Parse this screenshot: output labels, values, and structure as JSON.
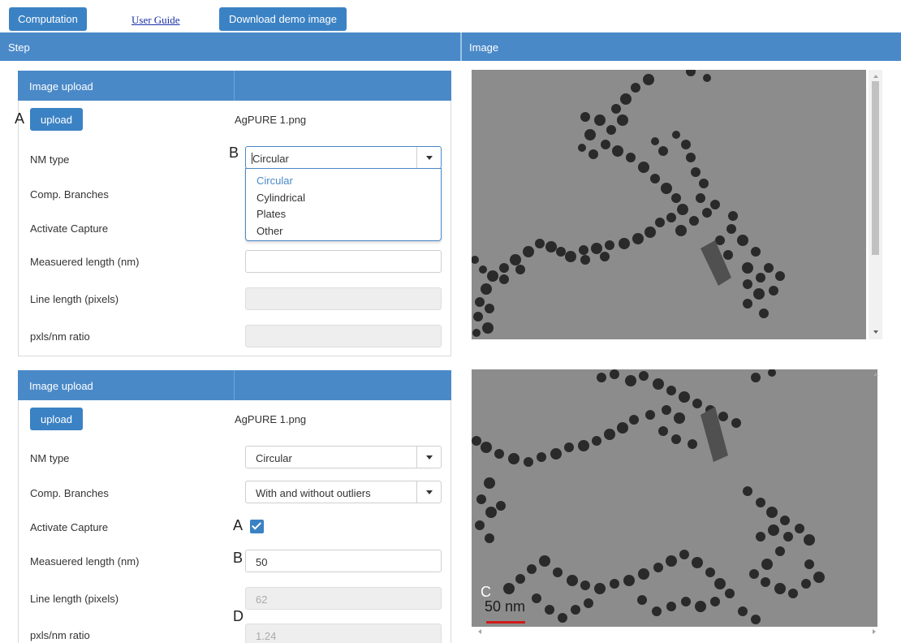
{
  "nav": {
    "computation": "Computation",
    "user_guide": "User Guide",
    "download_demo": "Download demo image"
  },
  "header": {
    "step": "Step",
    "image": "Image"
  },
  "panel1": {
    "title": "Image upload",
    "upload_label": "upload",
    "filename": "AgPURE 1.png",
    "nm_type_label": "NM type",
    "nm_type_value": "Circular",
    "nm_type_options": [
      "Circular",
      "Cylindrical",
      "Plates",
      "Other"
    ],
    "comp_branches_label": "Comp. Branches",
    "activate_capture_label": "Activate Capture",
    "measured_length_label": "Measuered length (nm)",
    "measured_length_value": "",
    "line_length_label": "Line length (pixels)",
    "line_length_value": "",
    "ratio_label": "pxls/nm ratio",
    "ratio_value": ""
  },
  "panel2": {
    "title": "Image upload",
    "upload_label": "upload",
    "filename": "AgPURE 1.png",
    "nm_type_label": "NM type",
    "nm_type_value": "Circular",
    "comp_branches_label": "Comp. Branches",
    "comp_branches_value": "With and without outliers",
    "activate_capture_label": "Activate Capture",
    "activate_capture_checked": true,
    "measured_length_label": "Measuered length (nm)",
    "measured_length_value": "50",
    "line_length_label": "Line length (pixels)",
    "line_length_value": "62",
    "ratio_label": "pxls/nm ratio",
    "ratio_value": "1.24"
  },
  "markers": {
    "a1": "A",
    "b1": "B",
    "a2": "A",
    "b2": "B",
    "c2": "C",
    "d2": "D"
  },
  "viewer2": {
    "scale_bar_label": "50 nm"
  },
  "colors": {
    "primary": "#3b82c4",
    "header": "#4a89c8",
    "scale_bar": "#d11a1a"
  }
}
